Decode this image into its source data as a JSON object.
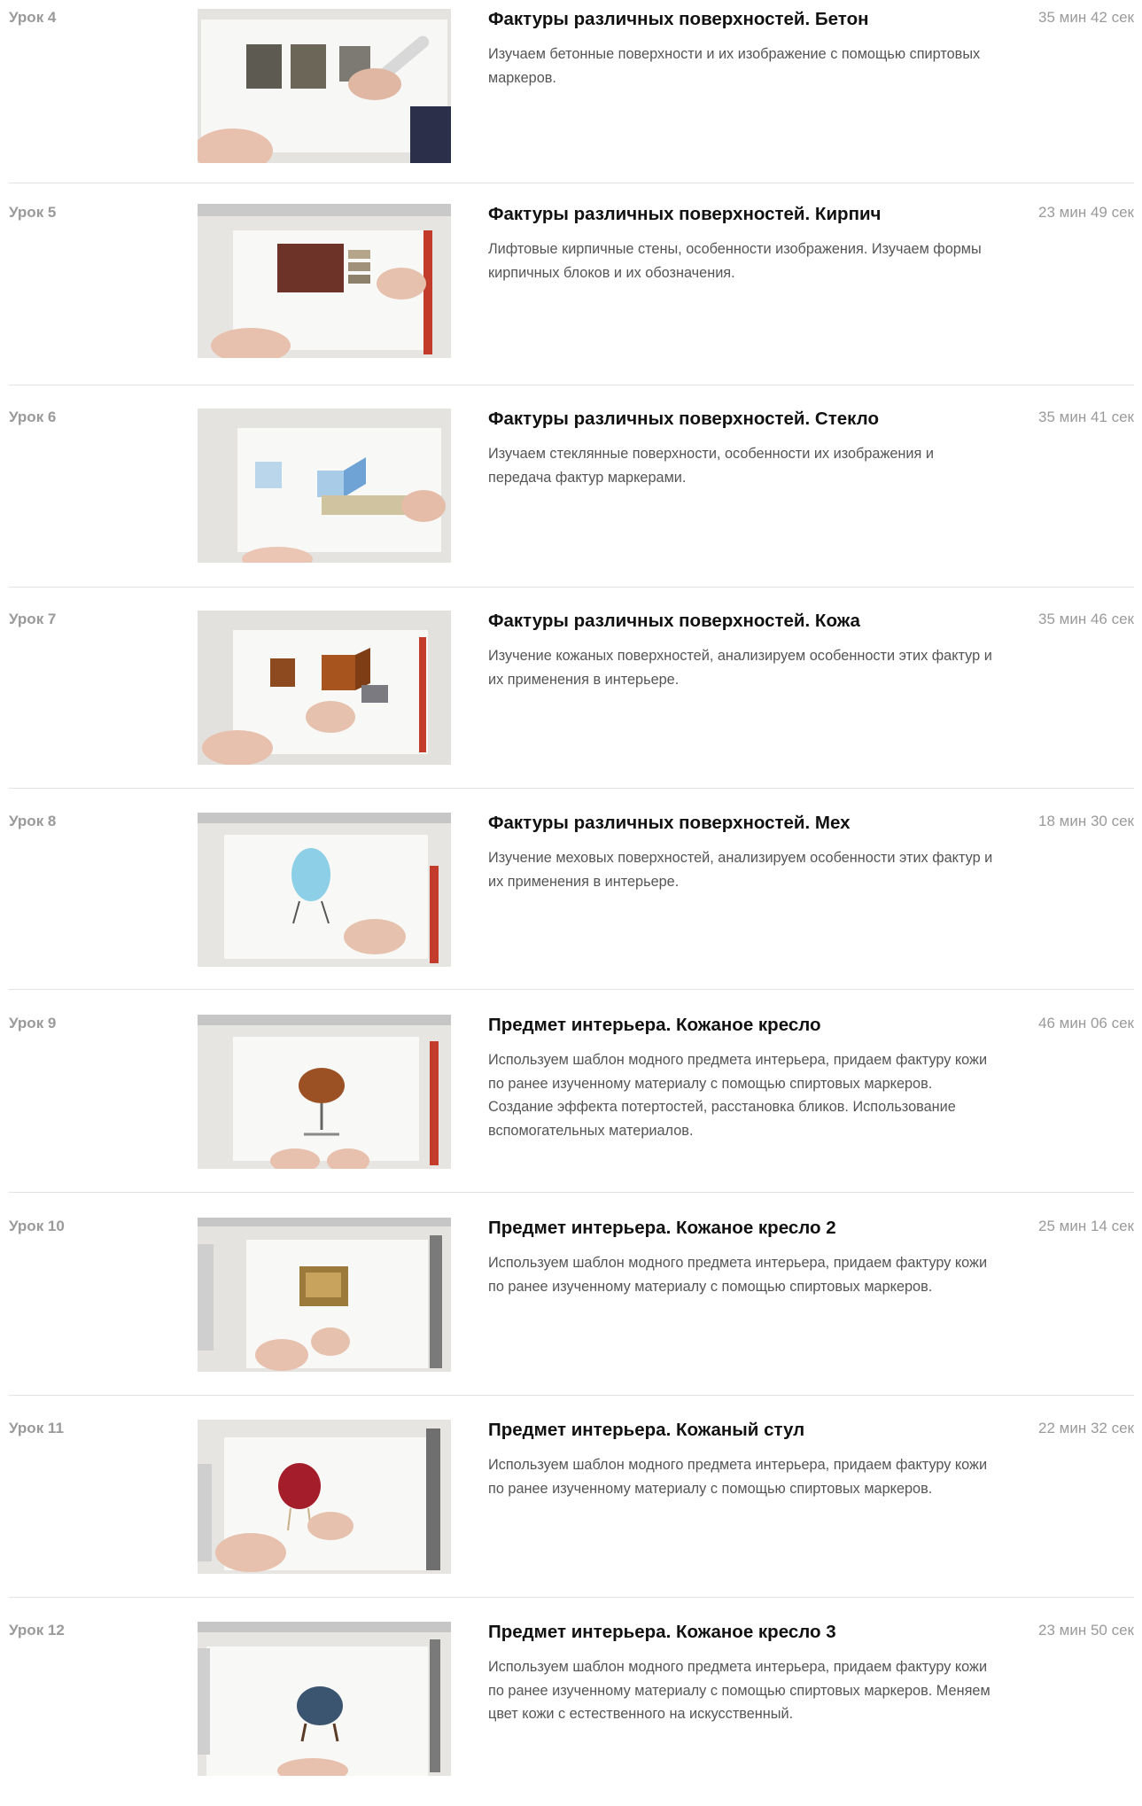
{
  "lessons": [
    {
      "number": "Урок 4",
      "title": "Фактуры различных поверхностей. Бетон",
      "description": "Изучаем бетонные поверхности и их изображение с помощью спиртовых маркеров.",
      "duration": "35 мин 42 сек"
    },
    {
      "number": "Урок 5",
      "title": "Фактуры различных поверхностей. Кирпич",
      "description": "Лифтовые кирпичные стены, особенности изображения. Изучаем формы кирпичных блоков и их обозначения.",
      "duration": "23 мин 49 сек"
    },
    {
      "number": "Урок 6",
      "title": "Фактуры различных поверхностей. Стекло",
      "description": "Изучаем стеклянные поверхности, особенности их изображения и передача фактур маркерами.",
      "duration": "35 мин 41 сек"
    },
    {
      "number": "Урок 7",
      "title": "Фактуры различных поверхностей. Кожа",
      "description": "Изучение кожаных поверхностей, анализируем особенности этих фактур и их применения в интерьере.",
      "duration": "35 мин 46 сек"
    },
    {
      "number": "Урок 8",
      "title": "Фактуры различных поверхностей. Мех",
      "description": "Изучение меховых поверхностей, анализируем особенности этих фактур и их применения в интерьере.",
      "duration": "18 мин 30 сек"
    },
    {
      "number": "Урок 9",
      "title": "Предмет интерьера. Кожаное кресло",
      "description": "Используем шаблон модного предмета интерьера, придаем фактуру кожи по ранее изученному материалу с помощью спиртовых маркеров. Создание эффекта потертостей, расстановка бликов. Использование вспомогательных материалов.",
      "duration": "46 мин 06 сек"
    },
    {
      "number": "Урок 10",
      "title": "Предмет интерьера. Кожаное кресло 2",
      "description": "Используем шаблон модного предмета интерьера, придаем фактуру кожи по ранее изученному материалу с помощью спиртовых маркеров.",
      "duration": "25 мин 14 сек"
    },
    {
      "number": "Урок 11",
      "title": "Предмет интерьера. Кожаный стул",
      "description": "Используем шаблон модного предмета интерьера, придаем фактуру кожи по ранее изученному материалу с помощью спиртовых маркеров.",
      "duration": "22 мин 32 сек"
    },
    {
      "number": "Урок 12",
      "title": "Предмет интерьера. Кожаное кресло 3",
      "description": "Используем шаблон модного предмета интерьера, придаем фактуру кожи по ранее изученному материалу с помощью спиртовых маркеров. Меняем цвет кожи с естественного на искусственный.",
      "duration": "23 мин 50 сек"
    }
  ]
}
